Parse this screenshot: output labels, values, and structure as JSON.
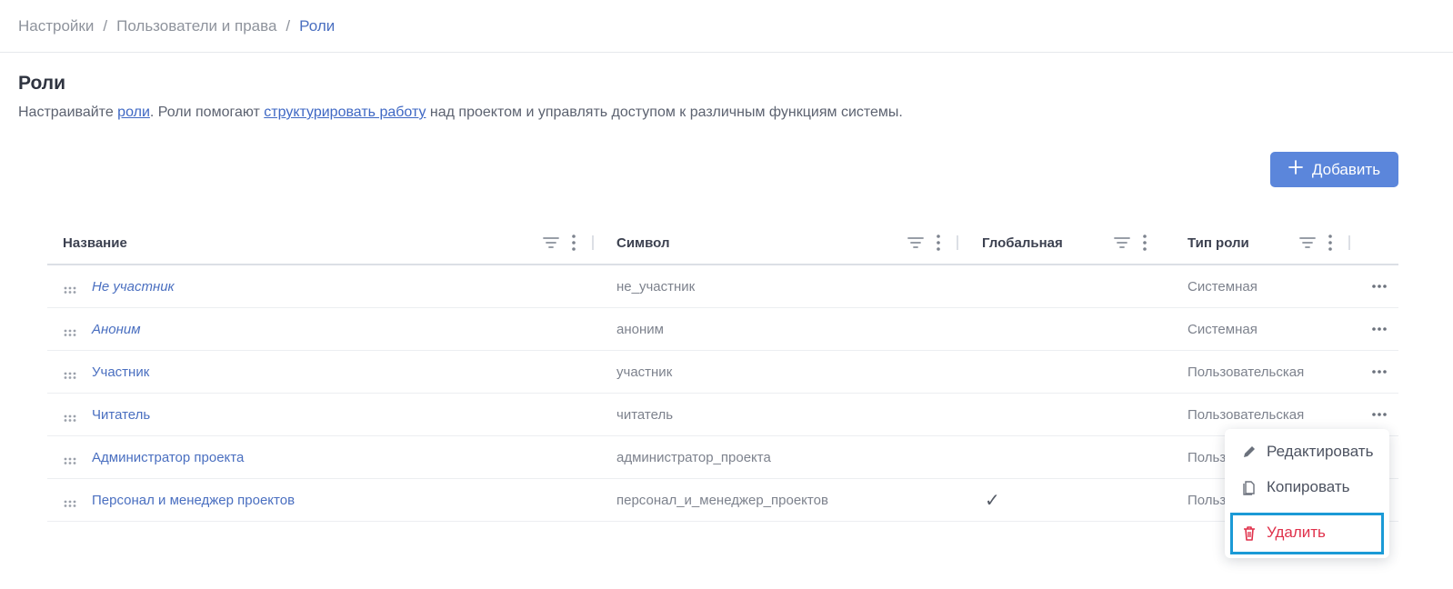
{
  "breadcrumb": {
    "items": [
      "Настройки",
      "Пользователи и права",
      "Роли"
    ],
    "separator": "/"
  },
  "page": {
    "title": "Роли",
    "desc_1": "Настраивайте ",
    "desc_link1": "роли",
    "desc_2": ". Роли помогают ",
    "desc_link2": "структурировать работу",
    "desc_3": " над проектом и управлять доступом к различным функциям системы."
  },
  "toolbar": {
    "add_label": "Добавить",
    "accent": "#5b86db"
  },
  "table": {
    "headers": [
      "Название",
      "Символ",
      "Глобальная",
      "Тип роли"
    ],
    "rows": [
      {
        "name": "Не участник",
        "italic": true,
        "symbol": "не_участник",
        "global": "",
        "type": "Системная"
      },
      {
        "name": "Аноним",
        "italic": true,
        "symbol": "аноним",
        "global": "",
        "type": "Системная"
      },
      {
        "name": "Участник",
        "italic": false,
        "symbol": "участник",
        "global": "",
        "type": "Пользовательская"
      },
      {
        "name": "Читатель",
        "italic": false,
        "symbol": "читатель",
        "global": "",
        "type": "Пользовательская"
      },
      {
        "name": "Администратор проекта",
        "italic": false,
        "symbol": "администратор_проекта",
        "global": "",
        "type": "Польз"
      },
      {
        "name": "Персонал и менеджер проектов",
        "italic": false,
        "symbol": "персонал_и_менеджер_проектов",
        "global": "✓",
        "type": "Польз"
      }
    ]
  },
  "context_menu": {
    "items": [
      {
        "label": "Редактировать",
        "icon": "pencil-icon"
      },
      {
        "label": "Копировать",
        "icon": "copy-icon"
      },
      {
        "label": "Удалить",
        "icon": "trash-icon",
        "color": "#e0314b"
      }
    ]
  },
  "colors": {
    "link": "#4a6fc0",
    "danger": "#e0314b",
    "highlight": "#1b9ad6"
  }
}
